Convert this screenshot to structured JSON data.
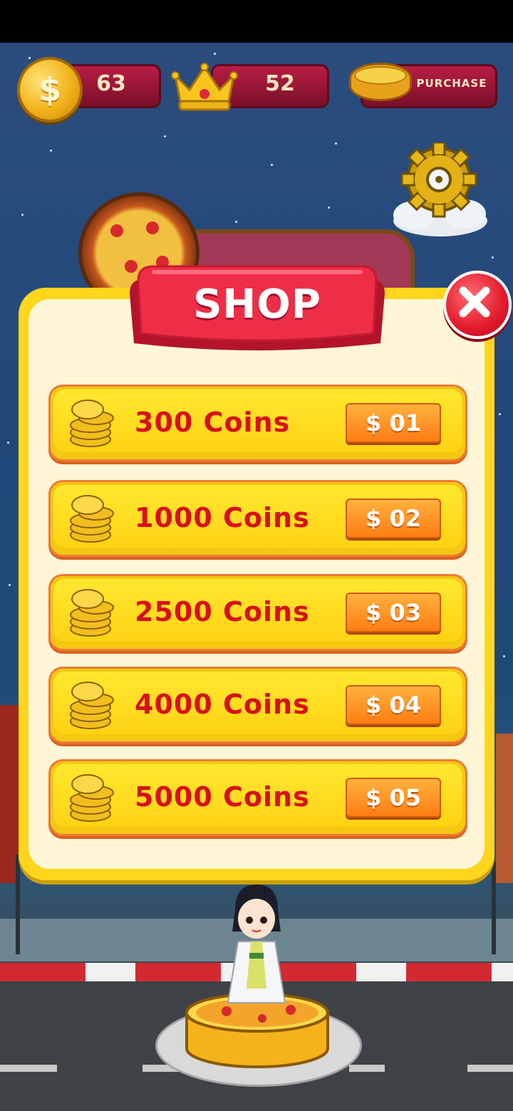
{
  "hud": {
    "coins": "63",
    "crowns": "52",
    "purchase_label": "PURCHASE",
    "coin_symbol": "$"
  },
  "shop": {
    "title": "SHOP",
    "items": [
      {
        "label": "300 Coins",
        "price": "$ 01"
      },
      {
        "label": "1000 Coins",
        "price": "$ 02"
      },
      {
        "label": "2500 Coins",
        "price": "$ 03"
      },
      {
        "label": "4000 Coins",
        "price": "$ 04"
      },
      {
        "label": "5000 Coins",
        "price": "$ 05"
      }
    ]
  },
  "icons": {
    "coin": "coin-icon",
    "crown": "crown-icon",
    "pizza_box": "pizza-box-icon",
    "settings": "gear-icon",
    "close": "close-icon",
    "coin_stack": "coin-stack-icon"
  },
  "colors": {
    "panel": "#ffd51d",
    "panel_inner": "#fff6d8",
    "ribbon": "#e8283e",
    "label_red": "#d8101a",
    "price_orange": "#ff8c1c",
    "hud_pill": "#a01838"
  }
}
